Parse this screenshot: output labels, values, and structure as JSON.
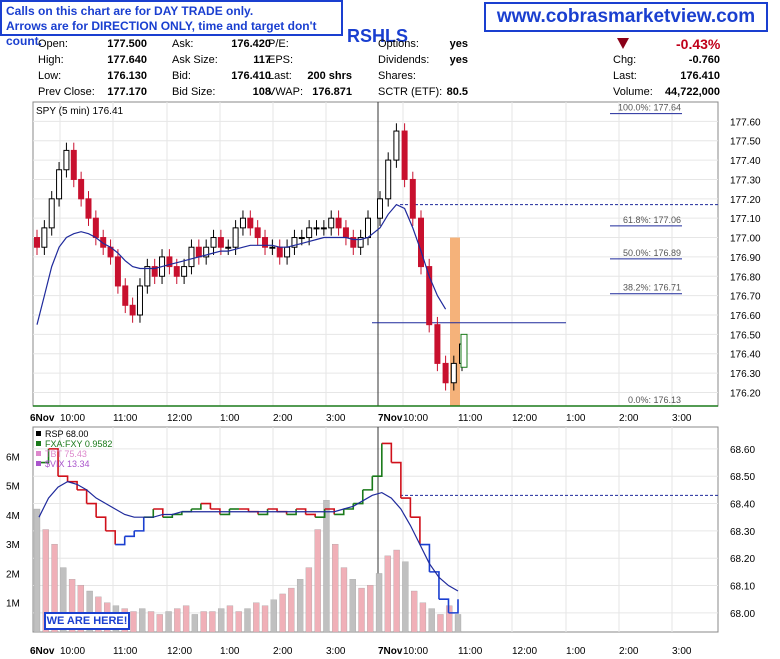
{
  "notice": {
    "line1": "Calls on this chart are for DAY TRADE only.",
    "line2": "Arrows are for DIRECTION ONLY, time and target don't count."
  },
  "website": "www.cobrasmarketview.com",
  "symbol": "RSHLS",
  "quote": {
    "rows": [
      [
        {
          "l": "Open:",
          "v": "177.500"
        },
        {
          "l": "Ask:",
          "v": "176.420"
        },
        {
          "l": "P/E:",
          "v": ""
        },
        {
          "l": "Options:",
          "v": "yes"
        }
      ],
      [
        {
          "l": "High:",
          "v": "177.640"
        },
        {
          "l": "Ask Size:",
          "v": "117"
        },
        {
          "l": "EPS:",
          "v": ""
        },
        {
          "l": "Dividends:",
          "v": "yes"
        }
      ],
      [
        {
          "l": "Low:",
          "v": "176.130"
        },
        {
          "l": "Bid:",
          "v": "176.410"
        },
        {
          "l": "Last:",
          "v": "200 shrs"
        },
        {
          "l": "Shares:",
          "v": ""
        }
      ],
      [
        {
          "l": "Prev Close:",
          "v": "177.170"
        },
        {
          "l": "Bid Size:",
          "v": "108"
        },
        {
          "l": "VWAP:",
          "v": "176.871"
        },
        {
          "l": "SCTR (ETF):",
          "v": "80.5"
        }
      ]
    ],
    "change_pct": "-0.43%",
    "right": [
      {
        "l": "Chg:",
        "v": "-0.760"
      },
      {
        "l": "Last:",
        "v": "176.410"
      },
      {
        "l": "Volume:",
        "v": "44,722,000"
      }
    ]
  },
  "callouts": {
    "here": "WE ARE HERE!"
  },
  "colors": {
    "up": "#ffffff",
    "down": "#c8102e",
    "ma": "#1f2a9c",
    "fib": "#1f2a9c",
    "orange": "#f5b27a",
    "green": "#1a7a1a",
    "blue": "#1a3fd0",
    "red": "#d0101a",
    "purple": "#cc88dd",
    "lime": "#99dd99",
    "vol_down": "#f0b0b8",
    "vol_up": "#c0c0c0"
  },
  "chart_data": [
    {
      "type": "candlestick",
      "title": "SPY (5 min) 176.41",
      "ylim": [
        176.13,
        177.7
      ],
      "yticks": [
        "177.60",
        "177.50",
        "177.40",
        "177.30",
        "177.20",
        "177.10",
        "177.00",
        "176.90",
        "176.80",
        "176.70",
        "176.60",
        "176.50",
        "176.40",
        "176.30",
        "176.20"
      ],
      "ytick_values": [
        177.6,
        177.5,
        177.4,
        177.3,
        177.2,
        177.1,
        177.0,
        176.9,
        176.8,
        176.7,
        176.6,
        176.5,
        176.4,
        176.3,
        176.2
      ],
      "xticks": [
        "6Nov",
        "10:00",
        "11:00",
        "12:00",
        "1:00",
        "2:00",
        "3:00",
        "7Nov",
        "10:00",
        "11:00",
        "12:00",
        "1:00",
        "2:00",
        "3:00"
      ],
      "fib_levels": [
        {
          "label": "100.0%: 177.64",
          "value": 177.64
        },
        {
          "label": "61.8%: 177.06",
          "value": 177.06
        },
        {
          "label": "50.0%: 176.89",
          "value": 176.89
        },
        {
          "label": "38.2%: 176.71",
          "value": 176.71
        },
        {
          "label": "0.0%: 176.13",
          "value": 176.13
        }
      ],
      "prev_close": 177.17,
      "support_line": 176.56,
      "close_series": [
        176.95,
        177.05,
        177.2,
        177.35,
        177.45,
        177.3,
        177.2,
        177.1,
        177.0,
        176.95,
        176.9,
        176.75,
        176.65,
        176.6,
        176.75,
        176.85,
        176.8,
        176.9,
        176.85,
        176.8,
        176.85,
        176.95,
        176.9,
        176.95,
        177.0,
        176.95,
        176.95,
        177.05,
        177.1,
        177.05,
        177.0,
        176.95,
        176.95,
        176.9,
        176.95,
        177.0,
        177.0,
        177.05,
        177.05,
        177.05,
        177.1,
        177.05,
        177.0,
        176.95,
        177.0,
        177.1,
        177.2,
        177.4,
        177.55,
        177.3,
        177.1,
        176.85,
        176.55,
        176.35,
        176.25,
        176.35,
        176.45
      ],
      "ma_series": [
        176.55,
        176.7,
        176.85,
        176.95,
        177.0,
        177.02,
        177.03,
        177.02,
        177.0,
        176.97,
        176.95,
        176.92,
        176.88,
        176.85,
        176.84,
        176.84,
        176.84,
        176.85,
        176.86,
        176.87,
        176.88,
        176.89,
        176.9,
        176.91,
        176.92,
        176.93,
        176.93,
        176.94,
        176.95,
        176.96,
        176.96,
        176.96,
        176.96,
        176.95,
        176.95,
        176.96,
        176.97,
        176.98,
        176.99,
        177.0,
        177.0,
        177.0,
        177.0,
        176.99,
        176.99,
        177.0,
        177.05,
        177.12,
        177.17,
        177.15,
        177.05,
        176.93,
        176.8,
        176.7,
        176.63
      ]
    },
    {
      "type": "line",
      "title": "RSP 68.00",
      "ylim": [
        67.93,
        68.68
      ],
      "yticks": [
        "68.60",
        "68.50",
        "68.40",
        "68.30",
        "68.20",
        "68.10",
        "68.00"
      ],
      "ytick_values": [
        68.6,
        68.5,
        68.4,
        68.3,
        68.2,
        68.1,
        68.0
      ],
      "volume_ticks": [
        "6M",
        "5M",
        "4M",
        "3M",
        "2M",
        "1M"
      ],
      "volume_tick_values": [
        6,
        5,
        4,
        3,
        2,
        1
      ],
      "xticks": [
        "6Nov",
        "10:00",
        "11:00",
        "12:00",
        "1:00",
        "2:00",
        "3:00",
        "7Nov",
        "10:00",
        "11:00",
        "12:00",
        "1:00",
        "2:00",
        "3:00"
      ],
      "legend": [
        {
          "name": "RSP 68.00",
          "color": "#000000"
        },
        {
          "name": "FXA:FXY 0.9582",
          "color": "#1a7a1a"
        },
        {
          "name": "TBT 75.43",
          "color": "#dd88cc"
        },
        {
          "name": "$VIX 13.34",
          "color": "#aa55cc"
        }
      ],
      "prev_close": 68.43,
      "series": [
        {
          "name": "RSP",
          "values": [
            68.55,
            68.6,
            68.5,
            68.48,
            68.45,
            68.4,
            68.35,
            68.3,
            68.25,
            68.28,
            68.3,
            68.35,
            68.38,
            68.35,
            68.36,
            68.37,
            68.38,
            68.4,
            68.38,
            68.36,
            68.38,
            68.38,
            68.37,
            68.36,
            68.38,
            68.37,
            68.36,
            68.38,
            68.36,
            68.35,
            68.38,
            68.36,
            68.38,
            68.4,
            68.45,
            68.5,
            68.62,
            68.55,
            68.42,
            68.35,
            68.25,
            68.15,
            68.05,
            68.0,
            68.05
          ]
        },
        {
          "name": "MA",
          "values": [
            68.35,
            68.42,
            68.46,
            68.48,
            68.47,
            68.45,
            68.42,
            68.4,
            68.38,
            68.36,
            68.35,
            68.35,
            68.35,
            68.36,
            68.36,
            68.37,
            68.37,
            68.37,
            68.37,
            68.37,
            68.37,
            68.37,
            68.37,
            68.37,
            68.37,
            68.37,
            68.37,
            68.37,
            68.37,
            68.37,
            68.37,
            68.37,
            68.38,
            68.39,
            68.41,
            68.43,
            68.44,
            68.42,
            68.38,
            68.32,
            68.25,
            68.18,
            68.13,
            68.1,
            68.08
          ]
        }
      ],
      "volume": [
        4.2,
        3.5,
        3.0,
        2.2,
        1.8,
        1.6,
        1.4,
        1.2,
        1.0,
        0.9,
        0.8,
        0.7,
        0.8,
        0.7,
        0.6,
        0.7,
        0.8,
        0.9,
        0.6,
        0.7,
        0.7,
        0.8,
        0.9,
        0.7,
        0.8,
        1.0,
        0.9,
        1.1,
        1.3,
        1.5,
        1.8,
        2.2,
        3.5,
        4.5,
        3.0,
        2.2,
        1.8,
        1.5,
        1.6,
        2.0,
        2.6,
        2.8,
        2.4,
        1.4,
        1.0,
        0.8,
        0.6,
        0.9,
        0.6
      ]
    }
  ]
}
